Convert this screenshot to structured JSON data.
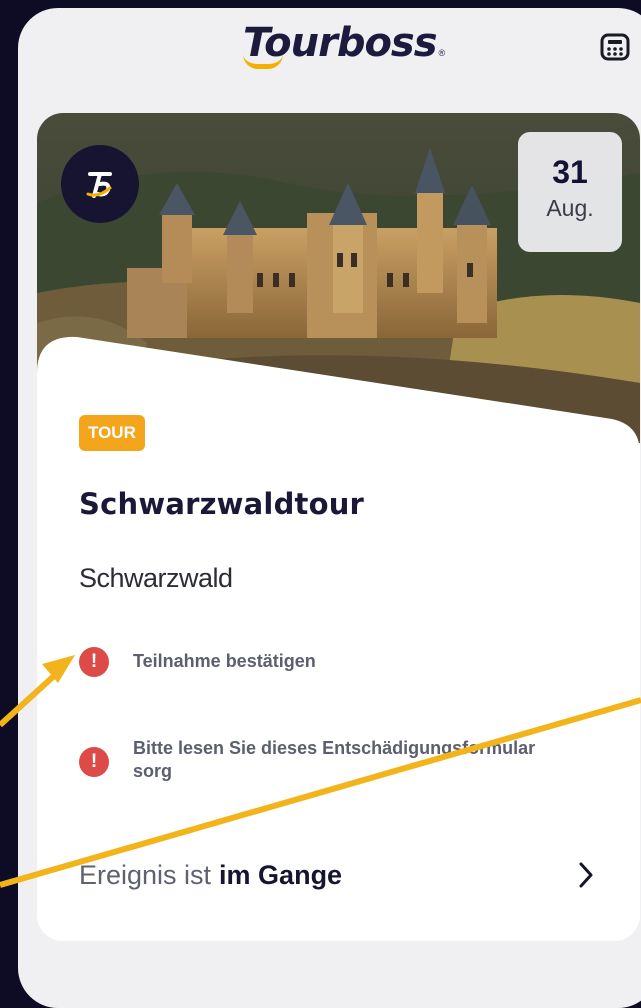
{
  "header": {
    "logo_text": "Tourboss",
    "logo_mark": "®",
    "calendar_icon": "calendar-icon"
  },
  "event": {
    "brand_badge_text": "TB",
    "date_day": "31",
    "date_month": "Aug.",
    "tag": "TOUR",
    "title": "Schwarzwaldtour",
    "location": "Schwarzwald",
    "notices": [
      {
        "icon": "alert-icon",
        "symbol": "!",
        "text": "Teilnahme bestätigen"
      },
      {
        "icon": "alert-icon",
        "symbol": "!",
        "text": "Bitte lesen Sie dieses Entschädigungsformular sorg"
      }
    ],
    "status_prefix": "Ereignis ist",
    "status_value": "im Gange",
    "chevron_icon": "chevron-right-icon"
  },
  "colors": {
    "background": "#0d0c24",
    "accent": "#f3a51b",
    "alert": "#dc4b48",
    "brand": "#171432"
  }
}
